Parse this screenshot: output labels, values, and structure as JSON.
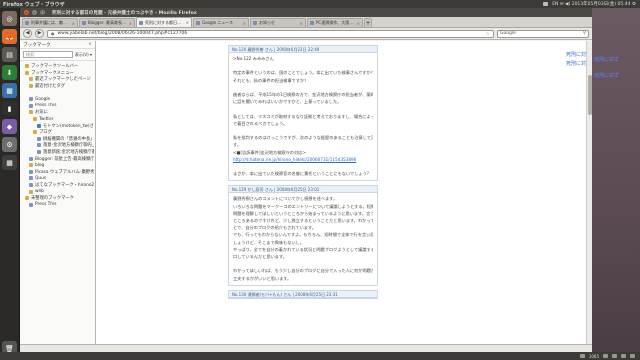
{
  "top_panel": {
    "app_title": "Firefox ウェブ・ブラウザ",
    "tray_text": "EN  ✉  ◀)  2013年05月03日(金) 05:44  ⚙"
  },
  "window": {
    "title": "死刑に対する都日の見聞 - 元検弁護士のつぶやき - Mozilla Firefox"
  },
  "tabs": [
    {
      "label": "刑事弁護には、敵対行為を...",
      "active": false
    },
    {
      "label": "Blogger: 最高裁長_弁護士会",
      "active": false
    },
    {
      "label": "死刑に対する都日の見聞",
      "active": true
    },
    {
      "label": "Google ニュース",
      "active": false
    },
    {
      "label": "お知らせ",
      "active": false
    },
    {
      "label": "PC遠隔操作、大阪の別居者...",
      "active": false
    }
  ],
  "navbar": {
    "url": "www.yabelab.net/blog/2008/06/26-100047.php#c127706",
    "search_engine": "Google",
    "search_icon": "search-icon"
  },
  "sidebar": {
    "header": "ブックマーク",
    "search_placeholder": "検索:",
    "view_label": "表示(V) ▾",
    "items": [
      {
        "label": "ブックマークツールバー",
        "indent": 1,
        "icon": "folder"
      },
      {
        "label": "ブックマークメニュー",
        "indent": 1,
        "icon": "folder"
      },
      {
        "label": "最近ブックマークしたページ",
        "indent": 2,
        "icon": "folder"
      },
      {
        "label": "最近付けたタグ",
        "indent": 2,
        "icon": "folder"
      },
      {
        "label": "",
        "indent": 0,
        "icon": "none"
      },
      {
        "label": "Google",
        "indent": 2,
        "icon": "page"
      },
      {
        "label": "Press This",
        "indent": 2,
        "icon": "page"
      },
      {
        "label": "お気に",
        "indent": 2,
        "icon": "folder"
      },
      {
        "label": "Twitter",
        "indent": 3,
        "icon": "folder"
      },
      {
        "label": "モトケン(motoken_tw)さんはT...",
        "indent": 4,
        "icon": "blue"
      },
      {
        "label": "ブログ",
        "indent": 3,
        "icon": "folder"
      },
      {
        "label": "桃桜機関の「普遍の中長」に元...",
        "indent": 4,
        "icon": "page"
      },
      {
        "label": "落意-金沢地方検察庁御内_ID...",
        "indent": 4,
        "icon": "page"
      },
      {
        "label": "落意新銘:金沢地方検察庁御中...",
        "indent": 4,
        "icon": "page"
      },
      {
        "label": "Blogger: 前星上告-最高検察庁旗中...",
        "indent": 2,
        "icon": "page"
      },
      {
        "label": "blog",
        "indent": 2,
        "icon": "folder"
      },
      {
        "label": "Picasa ウェブアルバム-廣野秀樹",
        "indent": 2,
        "icon": "page"
      },
      {
        "label": "Quus",
        "indent": 2,
        "icon": "page"
      },
      {
        "label": "はてなブックマーク・hirono2011のブ...",
        "indent": 2,
        "icon": "page"
      },
      {
        "label": "web",
        "indent": 2,
        "icon": "folder"
      },
      {
        "label": "未整理のブックマーク",
        "indent": 1,
        "icon": "folder"
      },
      {
        "label": "Press This",
        "indent": 2,
        "icon": "page"
      }
    ]
  },
  "comments": [
    {
      "header": "No.120 廣野秀樹 さん | 2008年6月22日 22:49",
      "lines": [
        ">No.122 みみみさん",
        "",
        "  特定の事件というのは、固のことでしょう。本に出ていた検事さんですか？",
        "  それとも、私の事件の担当検事ですか？",
        "",
        "  後者ならば、平成15年の1日検察の方で、金沢地方検察庁の担当者が、薬師◯◯検事",
        "に話を聞いてみればいいかですかと、上意っていました。",
        "",
        "  私としては、マスコミが取材するなり証拠と考えておりますし、場合によっては、国会",
        "で着目されるべきでしょう。",
        "",
        "  私を批判するのはけっこうですが、次のような経歴のあることも注意して頂きたいで",
        "す。",
        "<■[告訴事件]金沢地方検察庁の対応>",
        "http://d.hatena.ne.jp/hirono_hideki/20060731/1154353896",
        "",
        "  まさか、本に出ていた検察官の名誉に責任ということにもないでしょう?"
      ],
      "link_index": 14
    },
    {
      "header": "No.129 かし庭司 さん | 2008年6月25日 23:01",
      "lines": [
        "廣野秀樹さんのコメントについてかし感想を述べます。",
        "いろいろな問題をマークーコのエントリーについて議論しようとする。短期すべて自分の",
        "問題を理解してほしいというところから始まっているように思います。言うことでしょう。",
        "ところあるのですけれど、少し独立するということだと思います。わかってほしいというこ",
        "とで、自分のブログの紹介もされています。",
        "でも、行ってもわからないんですよ。もちろん、短時間で全体で行を言い読めばわかるんで",
        "しょうけど、そこまで興味もないし。",
        "やっぱり、全てを自分の着かれている状況と問題ブログようとして議論するのにみんな関",
        "口しているんだと思います。",
        "",
        "わかってほしいれば、もう少し自分のブログに自分で入った人に何が問題かわかるように",
        "工夫するかがいいと思います。"
      ],
      "link_index": -1
    },
    {
      "header": "No.130 通倒者(モバ+もん) さん | 2008年6月25日 23:31",
      "lines": [],
      "link_index": -1
    }
  ],
  "page_right_links": [
    "死刑に対す",
    "死刑に対す"
  ],
  "desktop_links": [
    "死刑に対す",
    "死刑に対す"
  ],
  "bottom_bar": {
    "counter": "1065"
  }
}
